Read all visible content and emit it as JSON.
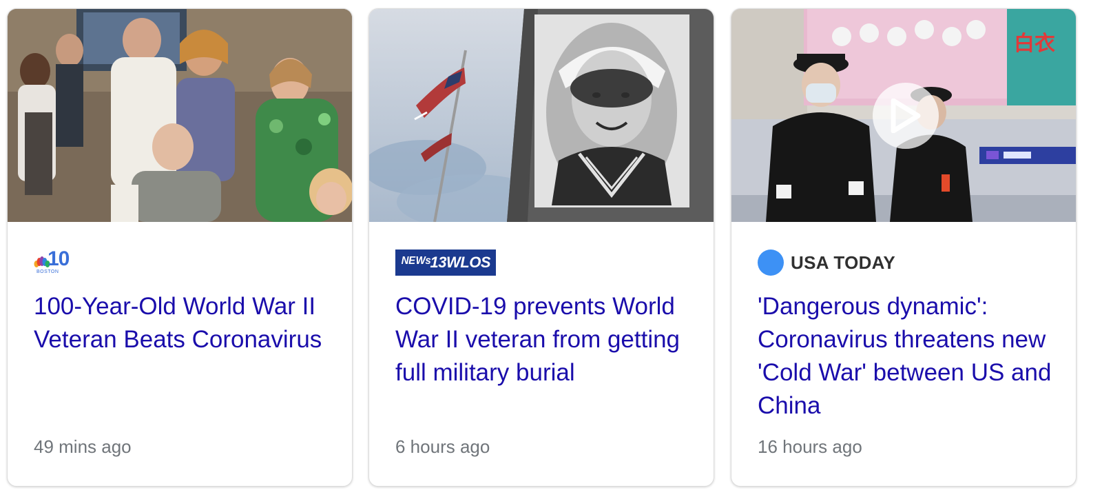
{
  "cards": [
    {
      "source": {
        "logo": "nbc10-boston-logo",
        "logo_number": "10",
        "logo_city": "BOSTON",
        "colors": {
          "peacock": [
            "#f5a623",
            "#e8402f",
            "#8e44ad",
            "#2e86de",
            "#27ae60",
            "#f1c40f"
          ],
          "text": "#3a6fd8"
        }
      },
      "headline": "100-Year-Old World War II Veteran Beats Coronavirus",
      "time": "49 mins ago",
      "thumbnail": "family-gathering-photo"
    },
    {
      "source": {
        "logo": "wlos-logo",
        "logo_text": "ᴺᴱᵂˢ13WLOS",
        "colors": {
          "background": "#1b3a8f",
          "text": "#ffffff"
        }
      },
      "headline": "COVID-19 prevents World War II veteran from getting full military burial",
      "time": "6 hours ago",
      "thumbnail": "sailor-portrait-and-flag-photo"
    },
    {
      "source": {
        "logo": "usa-today-logo",
        "name": "USA TODAY",
        "colors": {
          "dot": "#3d91f5",
          "text": "#303030"
        }
      },
      "headline": "'Dangerous dynamic': Coronavirus threatens new 'Cold War' between US and China",
      "time": "16 hours ago",
      "thumbnail": "police-officers-airport-video",
      "has_video": true,
      "thumb_sign_text": "白衣"
    }
  ],
  "colors": {
    "headline": "#1a0dab",
    "time": "#70757a",
    "card_border": "#dcdcdc"
  }
}
